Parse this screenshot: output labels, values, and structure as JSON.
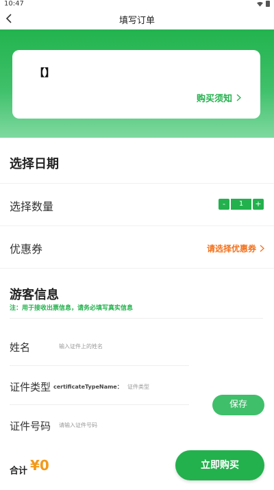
{
  "status_bar": {
    "time": "10:47"
  },
  "nav": {
    "title": "填写订单"
  },
  "product_card": {
    "title": "【】",
    "notice_link": "购买须知"
  },
  "date_section": {
    "title": "选择日期"
  },
  "quantity": {
    "label": "选择数量",
    "minus": "-",
    "value": "1",
    "plus": "+"
  },
  "coupon": {
    "label": "优惠券",
    "link": "请选择优惠券"
  },
  "tourist": {
    "title": "游客信息",
    "note": "注：用于接收出票信息，请务必填写真实信息",
    "name_label": "姓名",
    "name_placeholder": "输入证件上的姓名",
    "id_type_label": "证件类型",
    "id_type_key": "certificateTypeName：",
    "id_type_value": "证件类型",
    "id_number_label": "证件号码",
    "id_number_placeholder": "请输入证件号码",
    "save_button": "保存"
  },
  "footer": {
    "total_label": "合计",
    "total_value": "¥0",
    "buy_button": "立即购买"
  },
  "colors": {
    "brand_green": "#23b14d",
    "accent_orange": "#f2711c",
    "price_orange": "#f39a1a"
  }
}
